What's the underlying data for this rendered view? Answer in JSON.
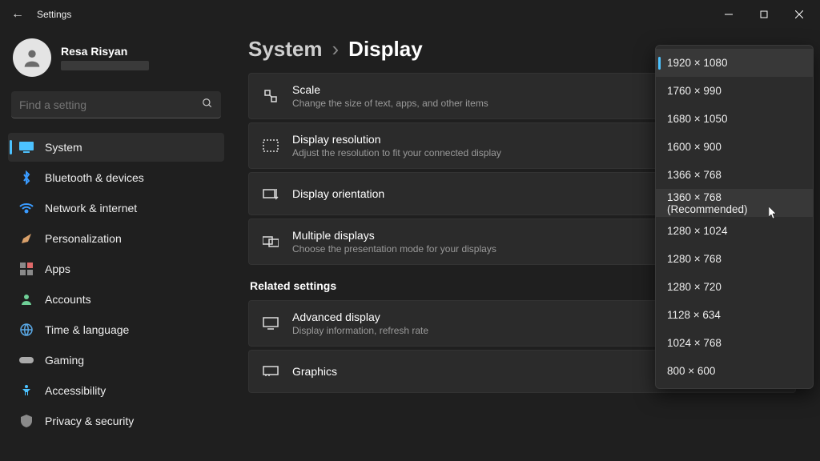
{
  "window": {
    "title": "Settings"
  },
  "user": {
    "name": "Resa Risyan"
  },
  "search": {
    "placeholder": "Find a setting"
  },
  "sidebar": {
    "items": [
      {
        "label": "System",
        "active": true
      },
      {
        "label": "Bluetooth & devices"
      },
      {
        "label": "Network & internet"
      },
      {
        "label": "Personalization"
      },
      {
        "label": "Apps"
      },
      {
        "label": "Accounts"
      },
      {
        "label": "Time & language"
      },
      {
        "label": "Gaming"
      },
      {
        "label": "Accessibility"
      },
      {
        "label": "Privacy & security"
      }
    ]
  },
  "breadcrumb": {
    "parent": "System",
    "sep": "›",
    "current": "Display"
  },
  "cards": {
    "scale": {
      "title": "Scale",
      "sub": "Change the size of text, apps, and other items"
    },
    "resolution": {
      "title": "Display resolution",
      "sub": "Adjust the resolution to fit your connected display"
    },
    "orientation": {
      "title": "Display orientation"
    },
    "multiple": {
      "title": "Multiple displays",
      "sub": "Choose the presentation mode for your displays"
    },
    "advanced": {
      "title": "Advanced display",
      "sub": "Display information, refresh rate"
    },
    "graphics": {
      "title": "Graphics"
    }
  },
  "section": {
    "related": "Related settings"
  },
  "dropdown": {
    "selected_index": 0,
    "hover_index": 5,
    "items": [
      "1920 × 1080",
      "1760 × 990",
      "1680 × 1050",
      "1600 × 900",
      "1366 × 768",
      "1360 × 768 (Recommended)",
      "1280 × 1024",
      "1280 × 768",
      "1280 × 720",
      "1128 × 634",
      "1024 × 768",
      "800 × 600"
    ]
  }
}
